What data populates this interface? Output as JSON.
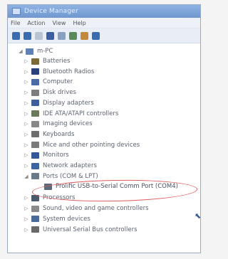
{
  "window": {
    "title": "Device Manager",
    "menu": [
      "File",
      "Action",
      "View",
      "Help"
    ]
  },
  "toolbar": {
    "icons": [
      "back-icon",
      "forward-icon",
      "properties-icon",
      "help-icon",
      "scan-icon",
      "update-icon",
      "uninstall-icon",
      "disable-icon"
    ]
  },
  "tree": {
    "root": "m-PC",
    "items": [
      {
        "label": "Batteries",
        "icon": "battery-icon",
        "color": "#7a6a3a"
      },
      {
        "label": "Bluetooth Radios",
        "icon": "bluetooth-icon",
        "color": "#2b3f7c"
      },
      {
        "label": "Computer",
        "icon": "computer-icon",
        "color": "#4a6aa8"
      },
      {
        "label": "Disk drives",
        "icon": "disk-icon",
        "color": "#7d7d7d"
      },
      {
        "label": "Display adapters",
        "icon": "display-icon",
        "color": "#3f5f9a"
      },
      {
        "label": "IDE ATA/ATAPI controllers",
        "icon": "ide-icon",
        "color": "#6a7a5a"
      },
      {
        "label": "Imaging devices",
        "icon": "camera-icon",
        "color": "#888888"
      },
      {
        "label": "Keyboards",
        "icon": "keyboard-icon",
        "color": "#6d6d6d"
      },
      {
        "label": "Mice and other pointing devices",
        "icon": "mouse-icon",
        "color": "#7a7a7a"
      },
      {
        "label": "Monitors",
        "icon": "monitor-icon",
        "color": "#35589a"
      },
      {
        "label": "Network adapters",
        "icon": "network-icon",
        "color": "#3c64a0"
      },
      {
        "label": "Ports (COM & LPT)",
        "icon": "port-icon",
        "color": "#6a7a8a"
      },
      {
        "label": "Prolific USB-to-Serial Comm Port (COM4)",
        "icon": "serial-port-icon",
        "color": "#5a6a7a",
        "sub": true
      },
      {
        "label": "Processors",
        "icon": "processor-icon",
        "color": "#4a5a6a"
      },
      {
        "label": "Sound, video and game controllers",
        "icon": "sound-icon",
        "color": "#8a8a8a"
      },
      {
        "label": "System devices",
        "icon": "system-icon",
        "color": "#4a6a9a"
      },
      {
        "label": "Universal Serial Bus controllers",
        "icon": "usb-icon",
        "color": "#6a6a6a"
      }
    ]
  },
  "colors": {
    "highlight_oval": "#e05a5a",
    "titlebar": "#7fa4da"
  }
}
